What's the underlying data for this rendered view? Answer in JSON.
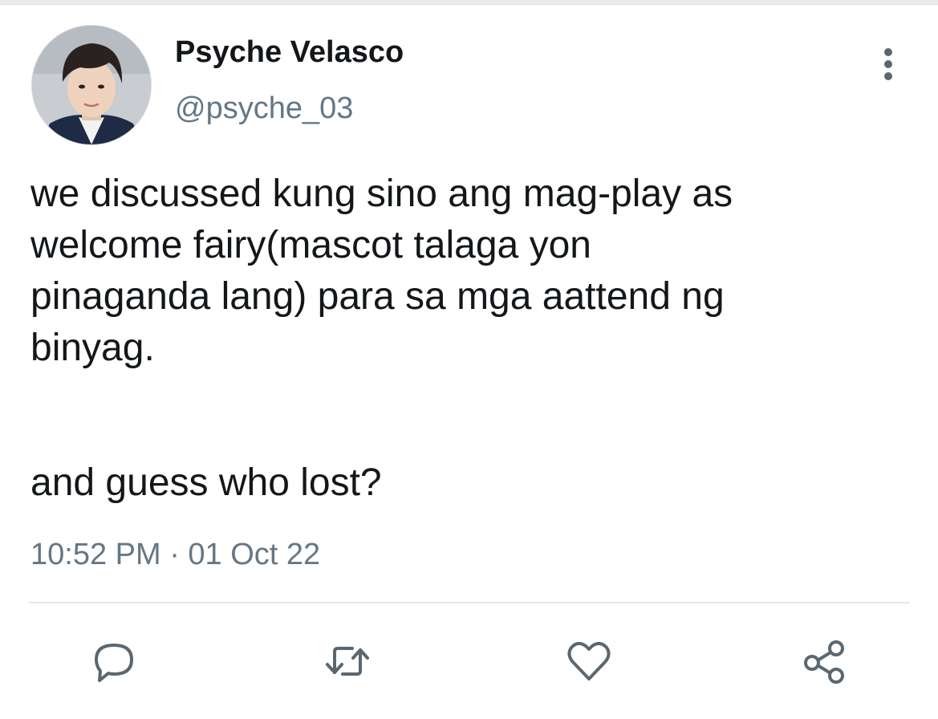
{
  "tweet": {
    "author": {
      "display_name": "Psyche Velasco",
      "handle": "@psyche_03"
    },
    "body_lines": [
      "we discussed kung sino ang mag-play as",
      "welcome fairy(mascot talaga yon",
      "pinaganda lang) para sa mga aattend ng",
      "binyag.",
      "",
      "and guess who lost?"
    ],
    "timestamp": "10:52 PM · 01 Oct 22"
  },
  "actions": [
    {
      "icon": "reply-icon"
    },
    {
      "icon": "retweet-icon"
    },
    {
      "icon": "like-icon"
    },
    {
      "icon": "share-icon"
    }
  ],
  "menu": {
    "icon": "more-options-icon"
  },
  "colors": {
    "text": "#14171a",
    "secondary": "#657786",
    "icon": "#5b6770",
    "divider": "#e1e6ea"
  }
}
